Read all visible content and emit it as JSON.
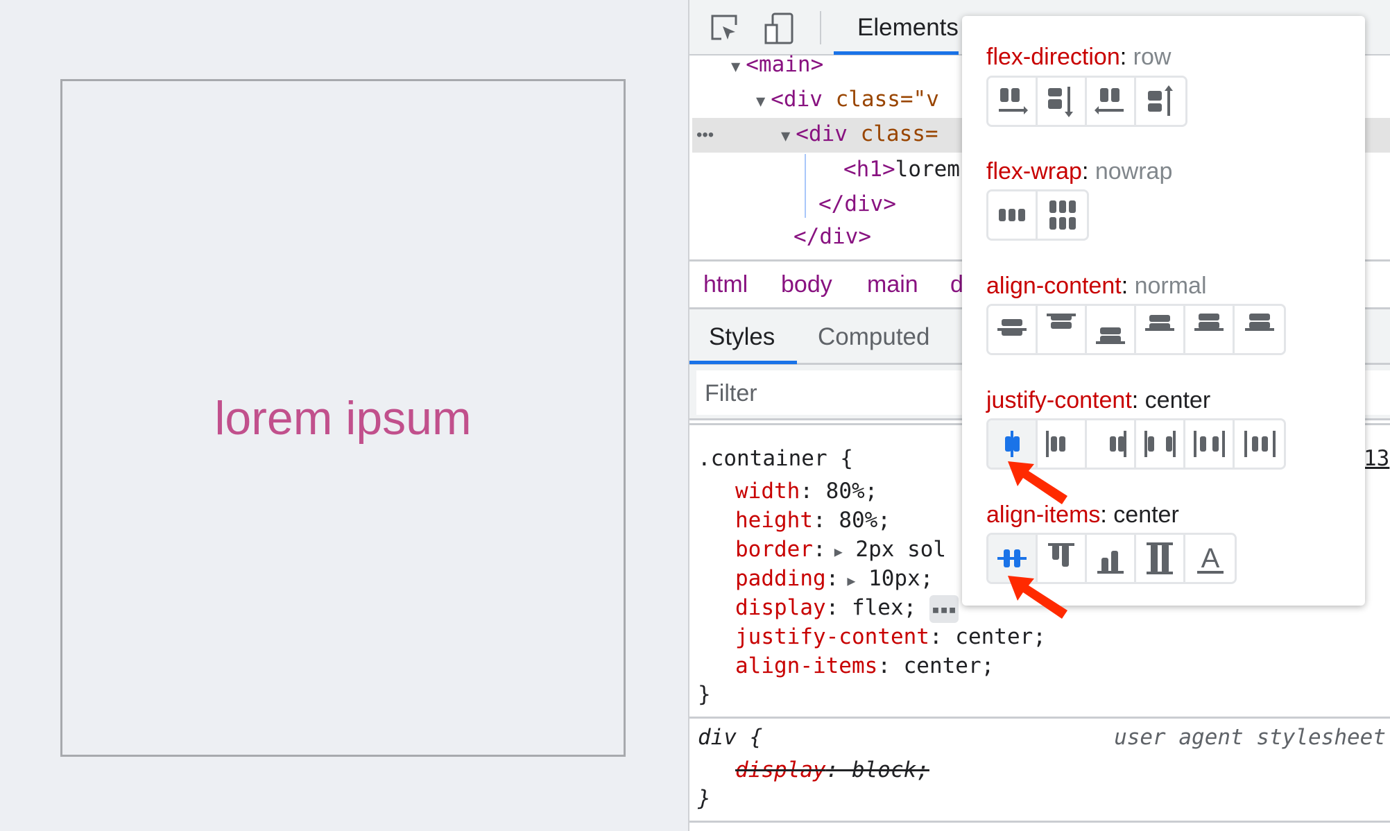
{
  "page": {
    "heading": "lorem ipsum"
  },
  "devtools": {
    "toolbar": {
      "tab_elements": "Elements"
    },
    "dom": [
      {
        "parts": [
          [
            "tag",
            "<main>"
          ]
        ]
      },
      {
        "parts": [
          [
            "tag",
            "<div "
          ],
          [
            "attr",
            "class=\"v"
          ]
        ]
      },
      {
        "parts": [
          [
            "tag",
            "<div "
          ],
          [
            "attr",
            "class="
          ]
        ]
      },
      {
        "parts": [
          [
            "tag",
            "<h1>"
          ],
          [
            "txt",
            "lorem"
          ]
        ]
      },
      {
        "parts": [
          [
            "tag",
            "</div>"
          ]
        ]
      },
      {
        "parts": [
          [
            "tag",
            "</div>"
          ]
        ]
      }
    ],
    "selected_dots": "•••",
    "breadcrumb": [
      "html",
      "body",
      "main",
      "d"
    ],
    "styles_tabs": [
      "Styles",
      "Computed"
    ],
    "filter_placeholder": "Filter",
    "rule": {
      "selector": ".container {",
      "source": "13",
      "decls": [
        [
          "width",
          "80%;"
        ],
        [
          "height",
          "80%;"
        ],
        [
          "border",
          "2px sol"
        ],
        [
          "padding",
          "10px;"
        ],
        [
          "display",
          "flex;"
        ],
        [
          "justify-content",
          "center;"
        ],
        [
          "align-items",
          "center;"
        ]
      ],
      "close": "}"
    },
    "ua_rule": {
      "selector": "div {",
      "source": "user agent stylesheet",
      "decl": [
        "display",
        "block;"
      ],
      "close": "}"
    }
  },
  "flex_editor": {
    "flex_direction": {
      "name": "flex-direction",
      "value": "row",
      "icons": [
        "row-icon",
        "column-icon",
        "row-reverse-icon",
        "column-reverse-icon"
      ]
    },
    "flex_wrap": {
      "name": "flex-wrap",
      "value": "nowrap",
      "icons": [
        "nowrap-icon",
        "wrap-icon"
      ]
    },
    "align_content": {
      "name": "align-content",
      "value": "normal",
      "icons": [
        "center",
        "flex-start",
        "flex-end",
        "space-around",
        "space-between",
        "stretch"
      ]
    },
    "justify_content": {
      "name": "justify-content",
      "value": "center",
      "selected": "center",
      "icons": [
        "center",
        "flex-start",
        "flex-end",
        "space-between",
        "space-around",
        "space-evenly"
      ]
    },
    "align_items": {
      "name": "align-items",
      "value": "center",
      "selected": "center",
      "icons": [
        "center",
        "flex-start",
        "flex-end",
        "stretch",
        "baseline"
      ]
    },
    "colors": {
      "active": "#1a73e8",
      "icon": "#5f6368",
      "annotation_arrow": "#ff2a00"
    }
  }
}
